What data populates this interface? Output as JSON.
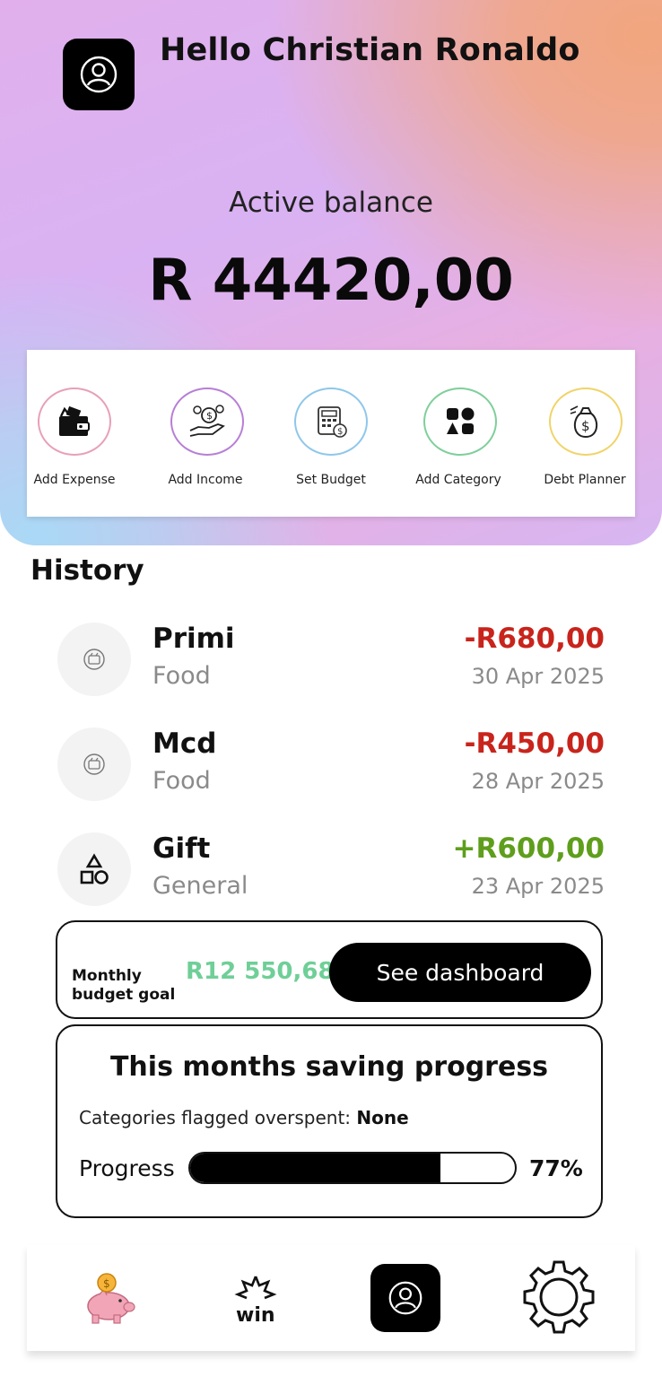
{
  "header": {
    "greeting": "Hello Christian Ronaldo",
    "balance_label": "Active balance",
    "balance_value": "R 44420,00"
  },
  "quick_actions": [
    {
      "label": "Add Expense",
      "icon": "wallet-icon",
      "ring_color": "#e7a0b8"
    },
    {
      "label": "Add Income",
      "icon": "money-hand-icon",
      "ring_color": "#b77fd6"
    },
    {
      "label": "Set Budget",
      "icon": "calculator-icon",
      "ring_color": "#8fc7ea"
    },
    {
      "label": "Add Category",
      "icon": "shapes-icon",
      "ring_color": "#7fcf9a"
    },
    {
      "label": "Debt Planner",
      "icon": "money-bag-icon",
      "ring_color": "#f0d46a"
    }
  ],
  "history": {
    "title": "History",
    "items": [
      {
        "name": "Primi",
        "category": "Food",
        "amount": "-R680,00",
        "date": "30 Apr 2025",
        "type": "expense",
        "icon": "food-icon"
      },
      {
        "name": "Mcd",
        "category": "Food",
        "amount": "-R450,00",
        "date": "28 Apr 2025",
        "type": "expense",
        "icon": "food-icon"
      },
      {
        "name": "Gift",
        "category": "General",
        "amount": "+R600,00",
        "date": "23 Apr 2025",
        "type": "income",
        "icon": "shapes-icon"
      }
    ]
  },
  "budget": {
    "label": "Monthly budget goal",
    "value": "R12 550,68",
    "button_label": "See dashboard"
  },
  "saving": {
    "title": "This months saving progress",
    "flag_label": "Categories flagged overspent:",
    "flag_value": "None",
    "progress_label": "Progress",
    "progress_percent": 77,
    "progress_text": "77%"
  },
  "nav": [
    {
      "icon": "piggy-bank-icon"
    },
    {
      "icon": "win-icon",
      "text": "win"
    },
    {
      "icon": "profile-icon"
    },
    {
      "icon": "settings-gear-icon"
    }
  ],
  "colors": {
    "expense": "#c8241c",
    "income": "#5f9e1c",
    "budget_value": "#6fcf97"
  }
}
